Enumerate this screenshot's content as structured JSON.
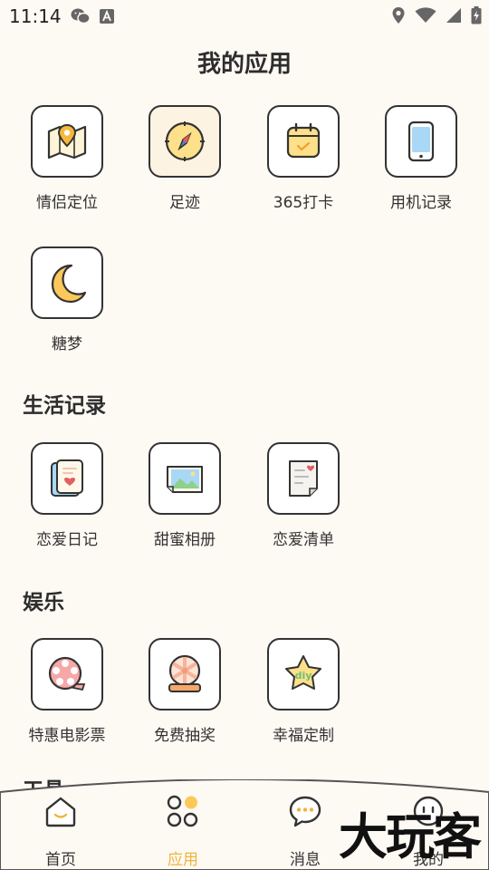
{
  "status_bar": {
    "time": "11:14",
    "left_icons": [
      "wechat-icon",
      "a-badge-icon"
    ],
    "right_icons": [
      "location-icon",
      "wifi-icon",
      "signal-icon",
      "battery-charging-icon"
    ]
  },
  "page": {
    "title": "我的应用"
  },
  "my_apps": [
    {
      "label": "情侣定位",
      "icon": "map-pin-icon"
    },
    {
      "label": "足迹",
      "icon": "compass-icon"
    },
    {
      "label": "365打卡",
      "icon": "calendar-check-icon"
    },
    {
      "label": "用机记录",
      "icon": "phone-icon"
    },
    {
      "label": "糖梦",
      "icon": "moon-icon"
    }
  ],
  "sections": {
    "life": {
      "title": "生活记录",
      "apps": [
        {
          "label": "恋爱日记",
          "icon": "diary-icon"
        },
        {
          "label": "甜蜜相册",
          "icon": "photo-album-icon"
        },
        {
          "label": "恋爱清单",
          "icon": "checklist-icon"
        }
      ]
    },
    "entertainment": {
      "title": "娱乐",
      "apps": [
        {
          "label": "特惠电影票",
          "icon": "film-reel-icon"
        },
        {
          "label": "免费抽奖",
          "icon": "lottery-ball-icon"
        },
        {
          "label": "幸福定制",
          "icon": "diy-star-icon"
        }
      ]
    },
    "tools": {
      "title": "工具"
    }
  },
  "bottom_nav": [
    {
      "label": "首页",
      "icon": "home-icon",
      "active": false
    },
    {
      "label": "应用",
      "icon": "apps-icon",
      "active": true
    },
    {
      "label": "消息",
      "icon": "message-icon",
      "active": false
    },
    {
      "label": "我的",
      "icon": "profile-icon",
      "active": false
    }
  ],
  "watermark": {
    "text": "大玩客"
  },
  "colors": {
    "background": "#fdf9f3",
    "accent": "#f0b43c",
    "icon_yellow": "#fde08a",
    "icon_blue": "#a8d8f5",
    "outline": "#333333"
  }
}
